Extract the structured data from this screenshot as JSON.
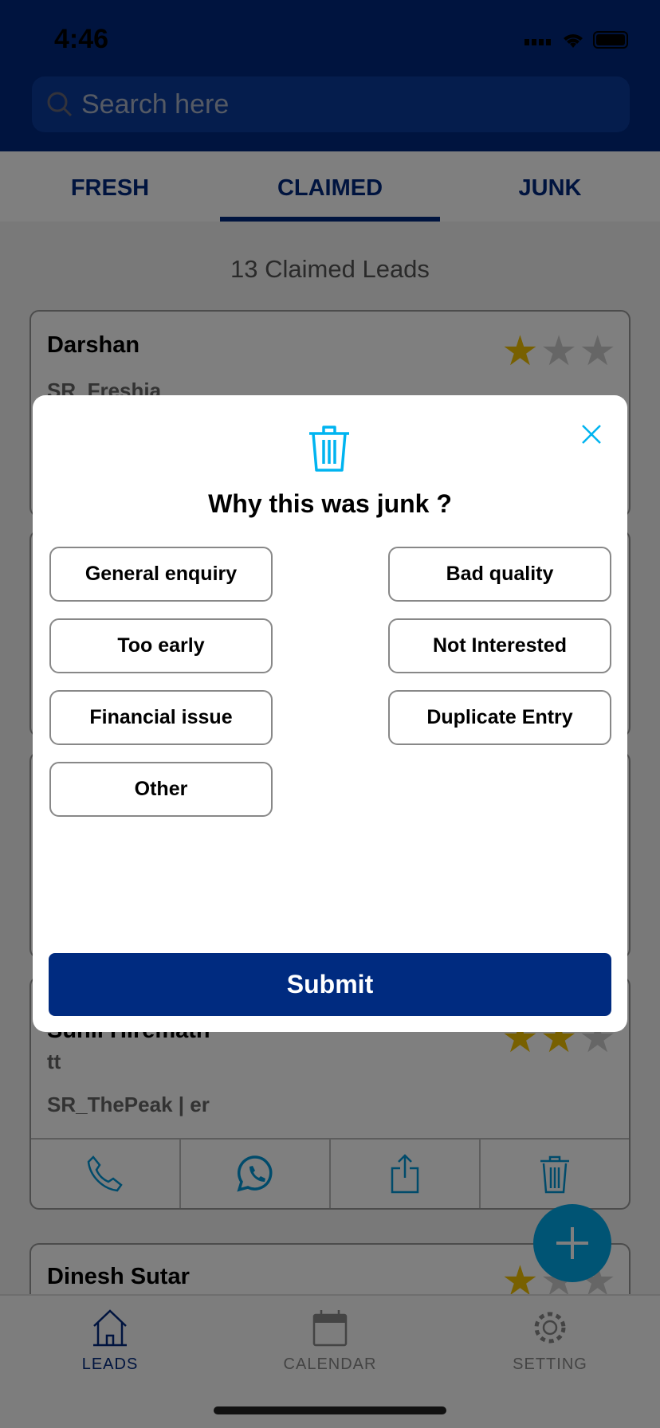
{
  "status_bar": {
    "time": "4:46"
  },
  "search": {
    "placeholder": "Search here"
  },
  "tabs": [
    {
      "label": "FRESH"
    },
    {
      "label": "CLAIMED"
    },
    {
      "label": "JUNK"
    }
  ],
  "leads_count": "13 Claimed Leads",
  "cards": [
    {
      "name": "Darshan",
      "source": "SR_Freshia",
      "rating": 1
    },
    {
      "name": "Sunil Hiremath",
      "note": "tt",
      "source": "SR_ThePeak | er",
      "rating": 2
    },
    {
      "name": "Dinesh Sutar",
      "rating": 1
    }
  ],
  "modal": {
    "title": "Why this was junk ?",
    "options": [
      "General enquiry",
      "Bad quality",
      "Too early",
      "Not Interested",
      "Financial issue",
      "Duplicate Entry",
      "Other"
    ],
    "submit_label": "Submit"
  },
  "bottom_nav": [
    {
      "label": "LEADS"
    },
    {
      "label": "CALENDAR"
    },
    {
      "label": "SETTING"
    }
  ],
  "colors": {
    "primary": "#00287f",
    "accent": "#00a8e8",
    "star": "#f0c000"
  }
}
